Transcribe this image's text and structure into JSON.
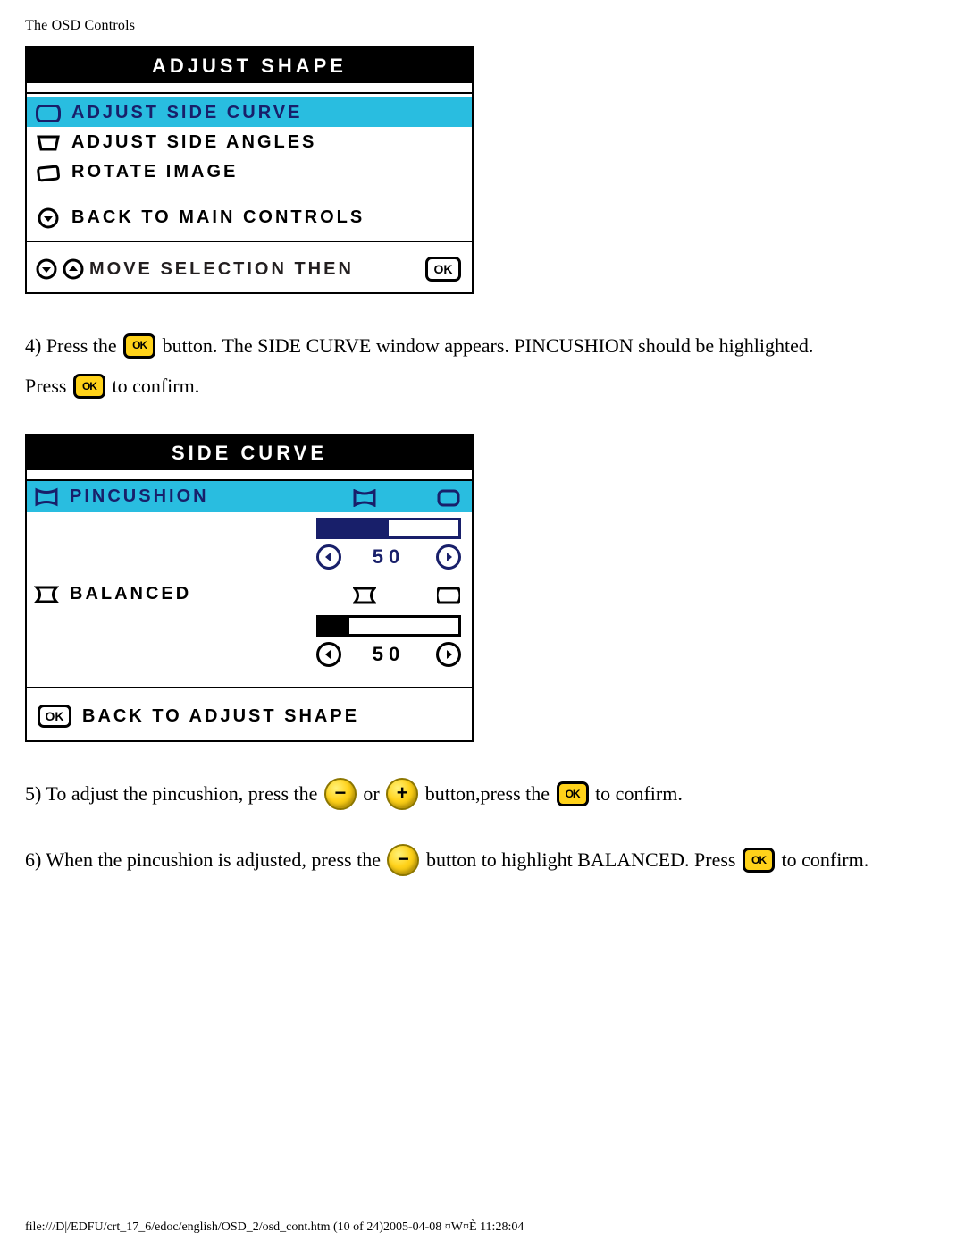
{
  "header": {
    "title": "The OSD Controls"
  },
  "panel1": {
    "title": "ADJUST SHAPE",
    "items": [
      {
        "label": "ADJUST SIDE CURVE",
        "selected": true
      },
      {
        "label": "ADJUST SIDE ANGLES",
        "selected": false
      },
      {
        "label": "ROTATE IMAGE",
        "selected": false
      }
    ],
    "back_label": "BACK TO MAIN CONTROLS",
    "footer_label": "MOVE SELECTION THEN",
    "ok_label": "OK"
  },
  "step4": {
    "a": "4) Press the ",
    "b": " button. The SIDE CURVE window appears. PINCUSHION should be highlighted. ",
    "c": "Press ",
    "d": " to confirm."
  },
  "panel2": {
    "title": "SIDE CURVE",
    "rows": [
      {
        "label": "PINCUSHION",
        "value": 50,
        "selected": true,
        "fill_percent": 50
      },
      {
        "label": "BALANCED",
        "value": 50,
        "selected": false,
        "fill_percent": 22
      }
    ],
    "back_label": "BACK TO ADJUST SHAPE",
    "ok_label": "OK"
  },
  "step5": {
    "a": "5) To adjust the pincushion, press the ",
    "or": " or ",
    "b": " button,press the ",
    "c": " to confirm."
  },
  "step6": {
    "a": "6) When the pincushion is adjusted, press the ",
    "b": " button to highlight BALANCED. Press ",
    "c": " to confirm."
  },
  "footer": {
    "text": "file:///D|/EDFU/crt_17_6/edoc/english/OSD_2/osd_cont.htm (10 of 24)2005-04-08 ¤W¤È 11:28:04"
  }
}
